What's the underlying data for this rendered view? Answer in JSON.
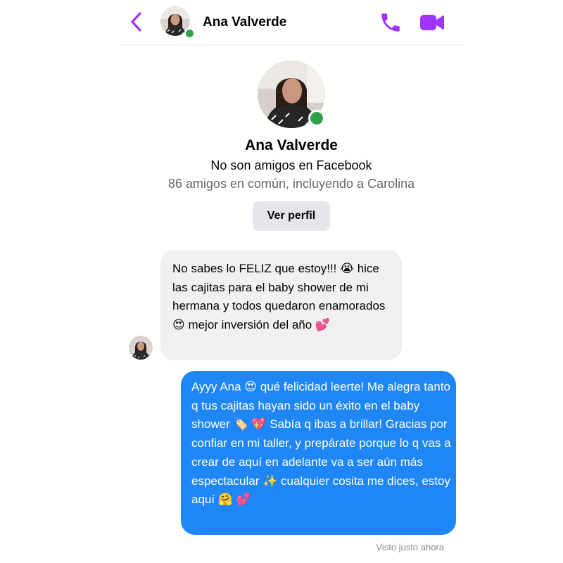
{
  "header": {
    "contact_name": "Ana Valverde",
    "back_icon": "chevron-left-icon",
    "call_icon": "phone-icon",
    "video_icon": "video-camera-icon",
    "accent_color": "#a033ff",
    "online_color": "#31a24c"
  },
  "profile": {
    "name": "Ana Valverde",
    "relationship": "No son amigos en Facebook",
    "mutual_friends": "86 amigos en común, incluyendo a Carolina",
    "view_profile_label": "Ver perfil"
  },
  "messages": [
    {
      "direction": "incoming",
      "text": "No sabes lo FELIZ que estoy!!! 😭 hice las cajitas para el baby shower de mi hermana y todos quedaron enamorados 😍 mejor inversión del año 💕"
    },
    {
      "direction": "outgoing",
      "text": "Ayyy Ana 😍 qué felicidad leerte! Me alegra tanto q tus cajitas hayan sido un éxito en el baby shower 🏷️ 💖 Sabía q ibas a brillar! Gracias por confiar en mi taller, y prepárate porque lo q vas a crear de aquí en adelante va a ser aún más espectacular ✨ cualquier cosita me dices, estoy aquí 🤗 💕"
    }
  ],
  "status": {
    "seen_text": "Visto justo ahora"
  },
  "colors": {
    "incoming_bubble": "#f0f0f0",
    "outgoing_bubble": "#1f86f5"
  }
}
